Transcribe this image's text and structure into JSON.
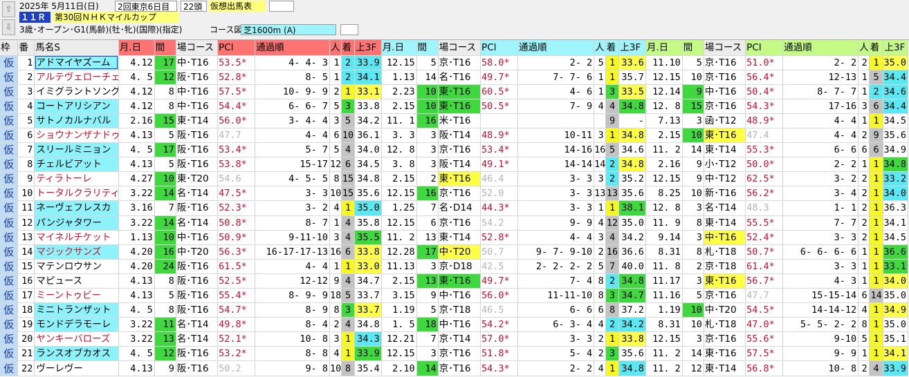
{
  "header": {
    "nav_up": "⇧",
    "nav_down": "⇩",
    "date": "2025年 5月11日(日)",
    "meeting": "2回東京6日目",
    "runners": "22頭",
    "mode": "仮想出馬表",
    "race_no": "１１Ｒ",
    "race_name": "第30回ＮＨＫマイルカップ",
    "conditions": "3歳･オープン･G1(馬齢)(牡･牝)(国際)(指定)",
    "course_label": "コース図",
    "course": "芝1600m (A)"
  },
  "columns": {
    "waku": "枠",
    "ban": "番",
    "name": "馬名S",
    "groups": [
      {
        "date": "月.日",
        "int": "間",
        "course": "場コース",
        "pci": "PCI",
        "pass": "通過順",
        "pop": "人",
        "fin": "着",
        "l3f": "上3F"
      },
      {
        "date": "月.日",
        "int": "間",
        "course": "場コース",
        "pci": "PCI",
        "pass": "通過順",
        "pop": "人",
        "fin": "着",
        "l3f": "上3F"
      },
      {
        "date": "月.日",
        "int": "間",
        "course": "場コース",
        "pci": "PCI",
        "pass": "通過順",
        "pop": "人",
        "fin": "着",
        "l3f": "上3F"
      }
    ]
  },
  "rows": [
    {
      "w": "仮",
      "no": "1",
      "name": "アドマイヤズーム",
      "r": [
        [
          "4.12",
          "17",
          "中･T16",
          "53.5*",
          "4- 4- 3",
          "1",
          "2",
          "33.9"
        ],
        [
          "12.15",
          "5",
          "京･T16",
          "58.0*",
          "2- 2",
          "5",
          "1",
          "33.6"
        ],
        [
          "11.10",
          "5",
          "京･T16",
          "51.0*",
          "2- 2",
          "2",
          "1",
          "35.0"
        ]
      ]
    },
    {
      "w": "仮",
      "no": "2",
      "name": "アルテヴェローチェ",
      "r": [
        [
          "4. 5",
          "12",
          "阪･T16",
          "52.8*",
          "8- 5",
          "1",
          "2",
          "34.1"
        ],
        [
          "1.13",
          "14",
          "名･T16",
          "49.7*",
          "7- 7- 6",
          "1",
          "1",
          "35.7"
        ],
        [
          "12.15",
          "10",
          "京･T16",
          "56.4*",
          "12-13",
          "1",
          "5",
          "34.4"
        ]
      ]
    },
    {
      "w": "仮",
      "no": "3",
      "name": "イミグラントソング",
      "r": [
        [
          "4.12",
          "8",
          "中･T16",
          "57.5*",
          "10- 9- 9",
          "2",
          "1",
          "33.1"
        ],
        [
          "2.23",
          "10",
          "東･T16",
          "60.5*",
          "4- 6",
          "1",
          "3",
          "33.5"
        ],
        [
          "12.14",
          "9",
          "中･T16",
          "50.4*",
          "8- 7- 7",
          "1",
          "2",
          "34.6"
        ]
      ]
    },
    {
      "w": "仮",
      "no": "4",
      "name": "コートアリシアン",
      "r": [
        [
          "4.12",
          "8",
          "中･T16",
          "54.4*",
          "6- 6- 7",
          "5",
          "3",
          "33.8"
        ],
        [
          "2.15",
          "10",
          "東･T16",
          "50.5*",
          "7- 9",
          "4",
          "4",
          "34.8"
        ],
        [
          "12. 8",
          "15",
          "京･T16",
          "54.3*",
          "17-16",
          "3",
          "6",
          "34.4"
        ]
      ]
    },
    {
      "w": "仮",
      "no": "5",
      "name": "サトノカルナバル",
      "r": [
        [
          "2.16",
          "15",
          "東･T14",
          "56.0*",
          "3- 4- 4",
          "3",
          "5",
          "34.2"
        ],
        [
          "11. 1",
          "16",
          "米･T16",
          "",
          "",
          "",
          "9",
          "-"
        ],
        [
          "7.13",
          "3",
          "函･T12",
          "48.9*",
          "4- 4",
          "1",
          "1",
          "34.5"
        ]
      ]
    },
    {
      "w": "仮",
      "no": "6",
      "name": "ショウナンザナドゥ",
      "r": [
        [
          "4.13",
          "5",
          "阪･T16",
          "47.7",
          "4- 4",
          "6",
          "10",
          "36.1"
        ],
        [
          "3. 3",
          "3",
          "阪･T14",
          "48.9*",
          "10-11",
          "3",
          "1",
          "34.8"
        ],
        [
          "2.15",
          "10",
          "東･T16",
          "47.4",
          "4- 4",
          "2",
          "9",
          "35.6"
        ]
      ]
    },
    {
      "w": "仮",
      "no": "7",
      "name": "スリールミニョン",
      "r": [
        [
          "4. 5",
          "17",
          "阪･T16",
          "53.4*",
          "5- 7",
          "5",
          "4",
          "34.0"
        ],
        [
          "12. 8",
          "3",
          "京･T16",
          "53.4*",
          "14-16",
          "16",
          "5",
          "34.6"
        ],
        [
          "11. 2",
          "14",
          "東･T14",
          "55.3*",
          "6- 6",
          "6",
          "6",
          "34.9"
        ]
      ]
    },
    {
      "w": "仮",
      "no": "8",
      "name": "チェルビアット",
      "r": [
        [
          "4.13",
          "5",
          "阪･T16",
          "53.8*",
          "15-17",
          "12",
          "6",
          "34.5"
        ],
        [
          "3. 8",
          "3",
          "阪･T14",
          "49.1*",
          "14-14",
          "14",
          "2",
          "34.8"
        ],
        [
          "2.16",
          "9",
          "小･T12",
          "50.0*",
          "2- 2",
          "1",
          "1",
          "34.8"
        ]
      ]
    },
    {
      "w": "仮",
      "no": "9",
      "name": "ティラトーレ",
      "r": [
        [
          "4.27",
          "10",
          "東･T20",
          "54.6",
          "4- 5- 5",
          "8",
          "15",
          "34.8"
        ],
        [
          "2.15",
          "2",
          "東･T16",
          "46.4",
          "3- 3",
          "3",
          "2",
          "35.2"
        ],
        [
          "12.15",
          "9",
          "中･T12",
          "62.5*",
          "3- 2",
          "2",
          "1",
          "33.2"
        ]
      ]
    },
    {
      "w": "仮",
      "no": "10",
      "name": "トータルクラリティ",
      "r": [
        [
          "3.22",
          "14",
          "名･T14",
          "47.5*",
          "3- 3",
          "10",
          "15",
          "35.6"
        ],
        [
          "12.15",
          "16",
          "京･T16",
          "52.0",
          "3- 3",
          "13",
          "13",
          "35.6"
        ],
        [
          "8.25",
          "10",
          "新･T16",
          "56.2*",
          "3- 4",
          "2",
          "1",
          "34.0"
        ]
      ]
    },
    {
      "w": "仮",
      "no": "11",
      "name": "ネーヴェフレスカ",
      "r": [
        [
          "3.16",
          "7",
          "阪･T16",
          "52.3*",
          "3- 2",
          "4",
          "1",
          "35.0"
        ],
        [
          "1.25",
          "7",
          "名･D14",
          "44.3*",
          "3- 3",
          "1",
          "1",
          "38.1"
        ],
        [
          "12. 8",
          "3",
          "名･T14",
          "48.3",
          "1- 1",
          "2",
          "1",
          "36.3"
        ]
      ]
    },
    {
      "w": "仮",
      "no": "12",
      "name": "パンジャタワー",
      "r": [
        [
          "3.22",
          "14",
          "名･T14",
          "50.8*",
          "8- 7",
          "1",
          "4",
          "35.8"
        ],
        [
          "12.15",
          "6",
          "京･T16",
          "54.2",
          "9- 9",
          "4",
          "12",
          "35.0"
        ],
        [
          "11. 9",
          "8",
          "東･T14",
          "55.5*",
          "7- 7",
          "2",
          "1",
          "34.1"
        ]
      ]
    },
    {
      "w": "仮",
      "no": "13",
      "name": "マイネルチケット",
      "r": [
        [
          "1.13",
          "10",
          "中･T16",
          "50.9*",
          "9-11-10",
          "3",
          "4",
          "35.5"
        ],
        [
          "11. 2",
          "13",
          "東･T14",
          "52.8*",
          "4- 4",
          "3",
          "4",
          "34.2"
        ],
        [
          "9.14",
          "3",
          "中･T16",
          "52.4*",
          "3- 3",
          "2",
          "1",
          "34.5"
        ]
      ]
    },
    {
      "w": "仮",
      "no": "14",
      "name": "マジックサンズ",
      "r": [
        [
          "4.20",
          "16",
          "中･T20",
          "56.3*",
          "16-17-17-13",
          "16",
          "6",
          "33.8"
        ],
        [
          "12.28",
          "17",
          "中･T20",
          "50.7",
          "9- 7- 9-10",
          "2",
          "16",
          "36.6"
        ],
        [
          "8.31",
          "8",
          "札･T18",
          "50.7*",
          "6- 6- 6- 6",
          "1",
          "1",
          "36.6"
        ]
      ]
    },
    {
      "w": "仮",
      "no": "15",
      "name": "マテンロウサン",
      "r": [
        [
          "4.20",
          "24",
          "阪･T16",
          "61.5*",
          "4- 4",
          "1",
          "1",
          "33.0"
        ],
        [
          "11.13",
          "3",
          "京･D18",
          "42.5",
          "2- 2- 2- 2",
          "5",
          "7",
          "40.0"
        ],
        [
          "11. 8",
          "2",
          "京･T18",
          "61.4*",
          "3- 3",
          "1",
          "1",
          "33.1"
        ]
      ]
    },
    {
      "w": "仮",
      "no": "16",
      "name": "マピュース",
      "r": [
        [
          "4.13",
          "8",
          "阪･T16",
          "52.5*",
          "12-12",
          "9",
          "4",
          "34.7"
        ],
        [
          "2.15",
          "13",
          "東･T16",
          "49.7*",
          "7- 4",
          "8",
          "2",
          "34.8"
        ],
        [
          "11.17",
          "3",
          "東･T16",
          "56.7*",
          "4- 3",
          "1",
          "1",
          "34.0"
        ]
      ]
    },
    {
      "w": "仮",
      "no": "17",
      "name": "ミーントゥビー",
      "r": [
        [
          "4.13",
          "5",
          "阪･T16",
          "55.4*",
          "8- 9- 9",
          "18",
          "5",
          "33.7"
        ],
        [
          "3.15",
          "9",
          "中･T16",
          "56.0*",
          "11-11-10",
          "8",
          "3",
          "34.7"
        ],
        [
          "11.16",
          "5",
          "京･T16",
          "47.7",
          "15-15-14",
          "6",
          "14",
          "35.0"
        ]
      ]
    },
    {
      "w": "仮",
      "no": "18",
      "name": "ミニトランザット",
      "r": [
        [
          "4. 5",
          "8",
          "阪･T16",
          "54.7*",
          "8- 9",
          "8",
          "3",
          "33.7"
        ],
        [
          "1.19",
          "5",
          "京･T18",
          "46.5",
          "6- 6",
          "6",
          "8",
          "37.2"
        ],
        [
          "1.19",
          "10",
          "中･T20",
          "54.5*",
          "14-14-12",
          "4",
          "1",
          "34.9"
        ]
      ]
    },
    {
      "w": "仮",
      "no": "19",
      "name": "モンドデラモーレ",
      "r": [
        [
          "3.22",
          "11",
          "名･T14",
          "49.8*",
          "8- 4",
          "2",
          "4",
          "34.8"
        ],
        [
          "1. 5",
          "18",
          "中･T16",
          "54.2*",
          "6- 3- 4",
          "4",
          "2",
          "34.2"
        ],
        [
          "8.31",
          "10",
          "札･T18",
          "47.0*",
          "5- 5- 2- 2",
          "8",
          "1",
          "35.0"
        ]
      ]
    },
    {
      "w": "仮",
      "no": "20",
      "name": "ヤンキーバローズ",
      "r": [
        [
          "3.22",
          "13",
          "名･T14",
          "52.1*",
          "10- 8",
          "3",
          "1",
          "34.3"
        ],
        [
          "12.21",
          "7",
          "京･T14",
          "57.0*",
          "3- 3",
          "2",
          "1",
          "33.8"
        ],
        [
          "12.15",
          "3",
          "京･T16",
          "55.6*",
          "9-10",
          "5",
          "1",
          "35.1"
        ]
      ]
    },
    {
      "w": "仮",
      "no": "21",
      "name": "ランスオブカオス",
      "r": [
        [
          "4. 5",
          "12",
          "阪･T16",
          "53.2*",
          "8- 8",
          "4",
          "1",
          "33.9"
        ],
        [
          "12.15",
          "3",
          "京･T16",
          "51.8*",
          "5- 4",
          "2",
          "3",
          "35.6"
        ],
        [
          "11. 2",
          "14",
          "東･T16",
          "57.5*",
          "9- 9",
          "1",
          "1",
          "34.1"
        ]
      ]
    },
    {
      "w": "仮",
      "no": "22",
      "name": "ヴーレヴー",
      "r": [
        [
          "4.13",
          "9",
          "阪･T16",
          "50.2",
          "9- 8",
          "10",
          "8",
          "35.4"
        ],
        [
          "2.10",
          "14",
          "京･T16",
          "54.3*",
          "2- 2",
          "4",
          "1",
          "34.8"
        ],
        [
          "11. 2",
          "12",
          "東･T14",
          "56.8*",
          "10- 8",
          "2",
          "4",
          "33.9"
        ]
      ]
    }
  ]
}
